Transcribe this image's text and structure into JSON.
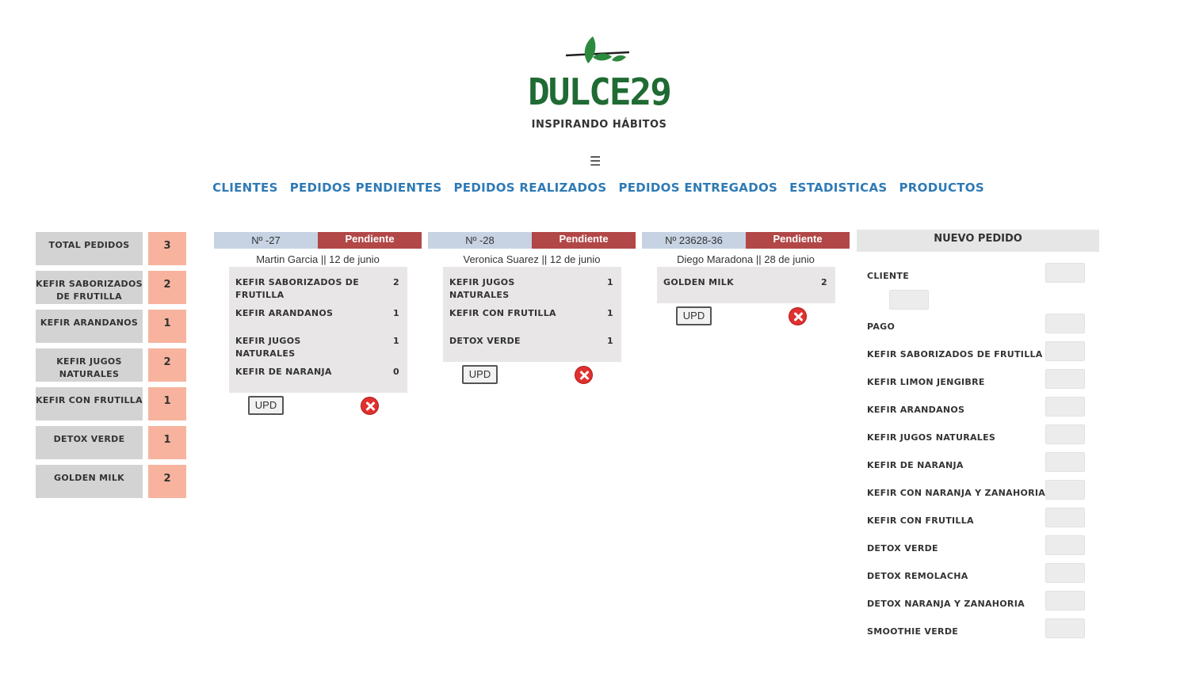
{
  "brand": {
    "name": "DULCE29",
    "tagline": "INSPIRANDO HÁBITOS",
    "color": "#1f6b33"
  },
  "menu_icon": "☰",
  "nav": [
    {
      "label": "CLIENTES"
    },
    {
      "label": "PEDIDOS PENDIENTES"
    },
    {
      "label": "PEDIDOS REALIZADOS"
    },
    {
      "label": "PEDIDOS ENTREGADOS"
    },
    {
      "label": "ESTADISTICAS"
    },
    {
      "label": "PRODUCTOS"
    }
  ],
  "totals": [
    {
      "label": "TOTAL PEDIDOS",
      "value": "3"
    },
    {
      "label": "KEFIR SABORIZADOS DE FRUTILLA",
      "value": "2"
    },
    {
      "label": "KEFIR ARANDANOS",
      "value": "1"
    },
    {
      "label": "KEFIR JUGOS NATURALES",
      "value": "2"
    },
    {
      "label": "KEFIR CON FRUTILLA",
      "value": "1"
    },
    {
      "label": "DETOX VERDE",
      "value": "1"
    },
    {
      "label": "GOLDEN MILK",
      "value": "2"
    }
  ],
  "orders": [
    {
      "number": "Nº -27",
      "status": "Pendiente",
      "client": "Martin Garcia || 12 de junio",
      "items": [
        {
          "name": "KEFIR SABORIZADOS DE FRUTILLA",
          "qty": "2"
        },
        {
          "name": "KEFIR ARANDANOS",
          "qty": "1"
        },
        {
          "name": "KEFIR JUGOS NATURALES",
          "qty": "1"
        },
        {
          "name": "KEFIR DE NARANJA",
          "qty": "0"
        }
      ],
      "upd_label": "UPD"
    },
    {
      "number": "Nº -28",
      "status": "Pendiente",
      "client": "Veronica Suarez || 12 de junio",
      "items": [
        {
          "name": "KEFIR JUGOS NATURALES",
          "qty": "1"
        },
        {
          "name": "KEFIR CON FRUTILLA",
          "qty": "1"
        },
        {
          "name": "DETOX VERDE",
          "qty": "1"
        }
      ],
      "upd_label": "UPD"
    },
    {
      "number": "Nº 23628-36",
      "status": "Pendiente",
      "client": "Diego Maradona || 28 de junio",
      "items": [
        {
          "name": "GOLDEN MILK",
          "qty": "2"
        }
      ],
      "upd_label": "UPD"
    }
  ],
  "nuevo_pedido": {
    "title": "NUEVO PEDIDO",
    "fields": [
      {
        "label": "CLIENTE",
        "value": ""
      },
      {
        "label": "PAGO",
        "value": ""
      },
      {
        "label": "KEFIR SABORIZADOS DE FRUTILLA",
        "value": ""
      },
      {
        "label": "KEFIR LIMON JENGIBRE",
        "value": ""
      },
      {
        "label": "KEFIR ARANDANOS",
        "value": ""
      },
      {
        "label": "KEFIR JUGOS NATURALES",
        "value": ""
      },
      {
        "label": "KEFIR DE NARANJA",
        "value": ""
      },
      {
        "label": "KEFIR CON NARANJA Y ZANAHORIA",
        "value": ""
      },
      {
        "label": "KEFIR CON FRUTILLA",
        "value": ""
      },
      {
        "label": "DETOX VERDE",
        "value": ""
      },
      {
        "label": "DETOX REMOLACHA",
        "value": ""
      },
      {
        "label": "DETOX NARANJA Y ZANAHORIA",
        "value": ""
      },
      {
        "label": "SMOOTHIE VERDE",
        "value": ""
      }
    ]
  },
  "colors": {
    "nav_link": "#2f7ab5",
    "status_pending": "#b24747",
    "order_number_bg": "#c7d3e3",
    "total_value_bg": "#f7b39e",
    "delete_icon": "#e0302f"
  }
}
